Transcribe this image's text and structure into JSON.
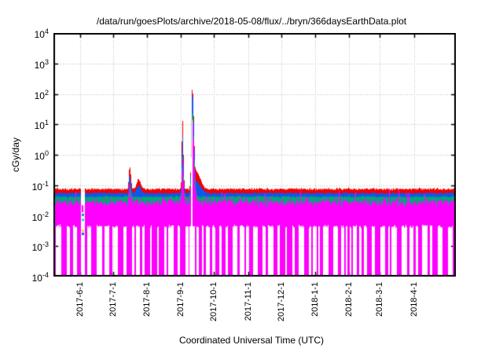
{
  "chart_data": {
    "type": "line",
    "title": "/data/run/goesPlots/archive/2018-05-08/flux/../bryn/366daysEarthData.plot",
    "xlabel": "Coordinated Universal Time (UTC)",
    "ylabel": "cGy/day",
    "x_start_date": "2017-05-08",
    "x_days": 366,
    "y_log_min_exp": -4,
    "y_log_max_exp": 4,
    "grid": true,
    "legend": "none",
    "background": "#ffffff",
    "axis_color": "#000000",
    "grid_color": "#bcbcbc",
    "gap_line_color": "#bdbdbd",
    "y_ticks": [
      4,
      3,
      2,
      1,
      0,
      -1,
      -2,
      -3,
      -4
    ],
    "x_ticks": [
      {
        "label": "2017-6-1",
        "day": 24
      },
      {
        "label": "2017-7-1",
        "day": 54
      },
      {
        "label": "2017-8-1",
        "day": 85
      },
      {
        "label": "2017-9-1",
        "day": 116
      },
      {
        "label": "2017-10-1",
        "day": 146
      },
      {
        "label": "2017-11-1",
        "day": 177
      },
      {
        "label": "2017-12-1",
        "day": 207
      },
      {
        "label": "2018-1-1",
        "day": 238
      },
      {
        "label": "2018-2-1",
        "day": 269
      },
      {
        "label": "2018-3-1",
        "day": 297
      },
      {
        "label": "2018-4-1",
        "day": 328
      }
    ],
    "series": [
      {
        "name": "red-flux",
        "color": "#f20000",
        "typical": 0.075,
        "noise_log10": 0.055,
        "draw_floor": 0.012
      },
      {
        "name": "blue-flux",
        "color": "#1155ee",
        "typical": 0.055,
        "noise_log10": 0.05,
        "draw_floor": 0.01
      },
      {
        "name": "green-flux",
        "color": "#00a878",
        "typical": 0.042,
        "noise_log10": 0.05,
        "draw_floor": 0.008
      },
      {
        "name": "magenta-flux",
        "color": "#ff00ff",
        "typical": 0.028,
        "noise_log10": 0.2,
        "flare_prob": 0.08,
        "flare_extra": 0.4,
        "floor_typical": 0.0045,
        "dropout_floor": 0.0001,
        "dropout_fraction": 0.5
      }
    ],
    "events": [
      {
        "date": "2017-07-16",
        "day": 69,
        "peaks": {
          "red-flux": 0.42,
          "blue-flux": 0.22,
          "green-flux": 0.09,
          "magenta-flux": 0.07
        },
        "sigma_days_rise": 0.7,
        "sigma_days_decay": 1.1
      },
      {
        "date": "2017-07-24",
        "day": 77,
        "peaks": {
          "red-flux": 0.16,
          "blue-flux": 0.1
        },
        "sigma_days_rise": 1.6,
        "sigma_days_decay": 2.0
      },
      {
        "date": "2017-09-04",
        "day": 117,
        "peaks": {
          "red-flux": 15,
          "blue-flux": 5,
          "green-flux": 1.0,
          "magenta-flux": 0.6
        },
        "sigma_days_rise": 0.55,
        "sigma_days_decay": 0.8
      },
      {
        "date": "2017-09-11",
        "day": 126,
        "peaks": {
          "red-flux": 165,
          "blue-flux": 115,
          "green-flux": 28,
          "magenta-flux": 17
        },
        "sigma_days_rise": 0.85,
        "sigma_days_decay": 1.5,
        "data_gap_line": true
      },
      {
        "date": "2017-09-14",
        "day": 129,
        "peaks": {
          "red-flux": 0.3,
          "blue-flux": 0.14
        },
        "sigma_days_rise": 1.5,
        "sigma_days_decay": 4.0
      }
    ],
    "data_gap": {
      "start_day": 25,
      "end_day": 28,
      "points": [
        {
          "color": "#ff00ff",
          "value": 0.022
        },
        {
          "color": "#00a878",
          "value": 0.011
        },
        {
          "color": "#00d4e8",
          "value": 0.0075
        },
        {
          "color": "#ffd400",
          "value": 0.0033
        },
        {
          "color": "#1155ee",
          "value": 0.0026
        }
      ]
    },
    "noise_seed": 20180508
  }
}
